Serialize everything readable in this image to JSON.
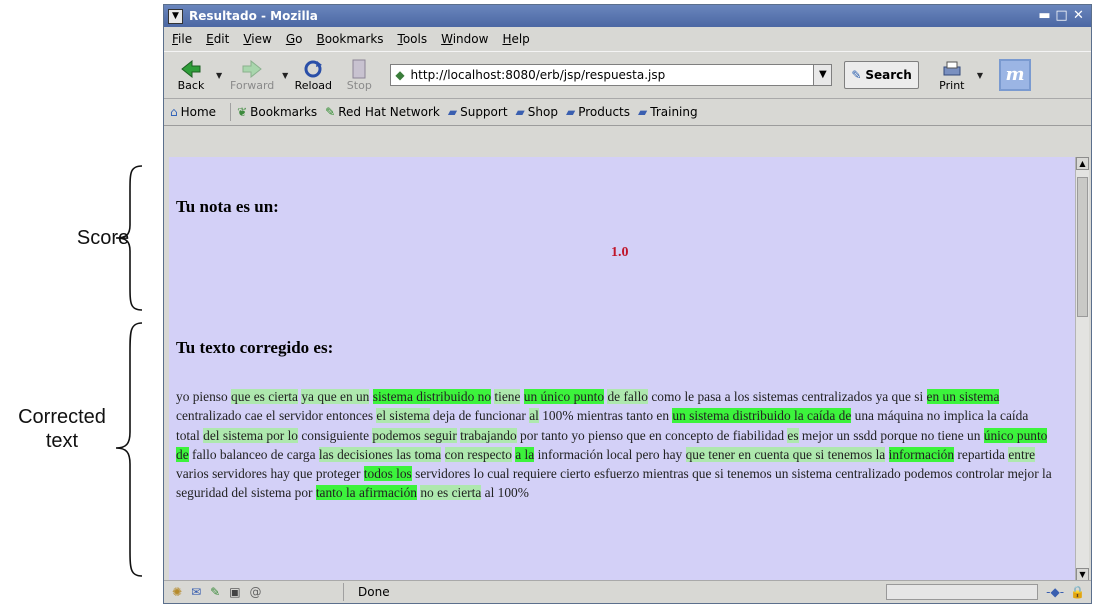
{
  "annotations": {
    "score_label": "Score",
    "corrected_label": "Corrected text"
  },
  "window": {
    "title": "Resultado - Mozilla",
    "controls": [
      "▬",
      "□",
      "✕"
    ]
  },
  "menu": [
    "File",
    "Edit",
    "View",
    "Go",
    "Bookmarks",
    "Tools",
    "Window",
    "Help"
  ],
  "toolbar": {
    "back": "Back",
    "forward": "Forward",
    "reload": "Reload",
    "stop": "Stop",
    "url": "http://localhost:8080/erb/jsp/respuesta.jsp",
    "search": "Search",
    "print": "Print"
  },
  "personal_bar": [
    "Home",
    "Bookmarks",
    "Red Hat Network",
    "Support",
    "Shop",
    "Products",
    "Training"
  ],
  "page": {
    "score_heading": "Tu nota es un:",
    "score_value": "1.0",
    "corrected_heading": "Tu texto corregido es:",
    "corrected_segments": [
      {
        "t": "yo pienso ",
        "h": "none"
      },
      {
        "t": "que es cierta",
        "h": "light"
      },
      {
        "t": " ",
        "h": "none"
      },
      {
        "t": "ya que en un",
        "h": "light"
      },
      {
        "t": " ",
        "h": "none"
      },
      {
        "t": "sistema distribuido no",
        "h": "strong"
      },
      {
        "t": " ",
        "h": "none"
      },
      {
        "t": "tiene",
        "h": "light"
      },
      {
        "t": " ",
        "h": "none"
      },
      {
        "t": "un único punto",
        "h": "strong"
      },
      {
        "t": " ",
        "h": "none"
      },
      {
        "t": "de fallo",
        "h": "light"
      },
      {
        "t": " como le pasa a los sistemas centralizados ya que si ",
        "h": "none"
      },
      {
        "t": "en un sistema",
        "h": "strong"
      },
      {
        "t": " centralizado cae el servidor entonces ",
        "h": "none"
      },
      {
        "t": "el sistema",
        "h": "light"
      },
      {
        "t": " deja de funcionar ",
        "h": "none"
      },
      {
        "t": "al",
        "h": "light"
      },
      {
        "t": " 100% mientras tanto en ",
        "h": "none"
      },
      {
        "t": "un sistema distribuido la caída de",
        "h": "strong"
      },
      {
        "t": " una máquina no implica la caída total ",
        "h": "none"
      },
      {
        "t": "del sistema por lo",
        "h": "light"
      },
      {
        "t": " consiguiente ",
        "h": "none"
      },
      {
        "t": "podemos seguir",
        "h": "light"
      },
      {
        "t": " ",
        "h": "none"
      },
      {
        "t": "trabajando",
        "h": "light"
      },
      {
        "t": " por tanto yo pienso que en concepto de fiabilidad ",
        "h": "none"
      },
      {
        "t": "es",
        "h": "light"
      },
      {
        "t": " mejor un ssdd porque no tiene un ",
        "h": "none"
      },
      {
        "t": "único punto de",
        "h": "strong"
      },
      {
        "t": " fallo balanceo de carga ",
        "h": "none"
      },
      {
        "t": "las decisiones las toma",
        "h": "light"
      },
      {
        "t": " ",
        "h": "none"
      },
      {
        "t": "con respecto",
        "h": "light"
      },
      {
        "t": " ",
        "h": "none"
      },
      {
        "t": "a la",
        "h": "strong"
      },
      {
        "t": " información local pero hay ",
        "h": "none"
      },
      {
        "t": "que tener en cuenta que si tenemos la",
        "h": "light"
      },
      {
        "t": " ",
        "h": "none"
      },
      {
        "t": "información",
        "h": "strong"
      },
      {
        "t": " repartida ",
        "h": "none"
      },
      {
        "t": "entre",
        "h": "light"
      },
      {
        "t": " varios servidores hay que proteger ",
        "h": "none"
      },
      {
        "t": "todos los",
        "h": "strong"
      },
      {
        "t": " servidores lo cual requiere cierto esfuerzo mientras que si tenemos un sistema centralizado podemos controlar mejor la seguridad del sistema por ",
        "h": "none"
      },
      {
        "t": "tanto la afirmación",
        "h": "strong"
      },
      {
        "t": " ",
        "h": "none"
      },
      {
        "t": "no es cierta",
        "h": "light"
      },
      {
        "t": " al 100%",
        "h": "none"
      }
    ]
  },
  "status": {
    "text": "Done"
  },
  "colors": {
    "page_background": "#d3d0f7",
    "highlight_strong": "#3cf33c",
    "highlight_light": "#aee8ae",
    "score_color": "#c0152a"
  }
}
